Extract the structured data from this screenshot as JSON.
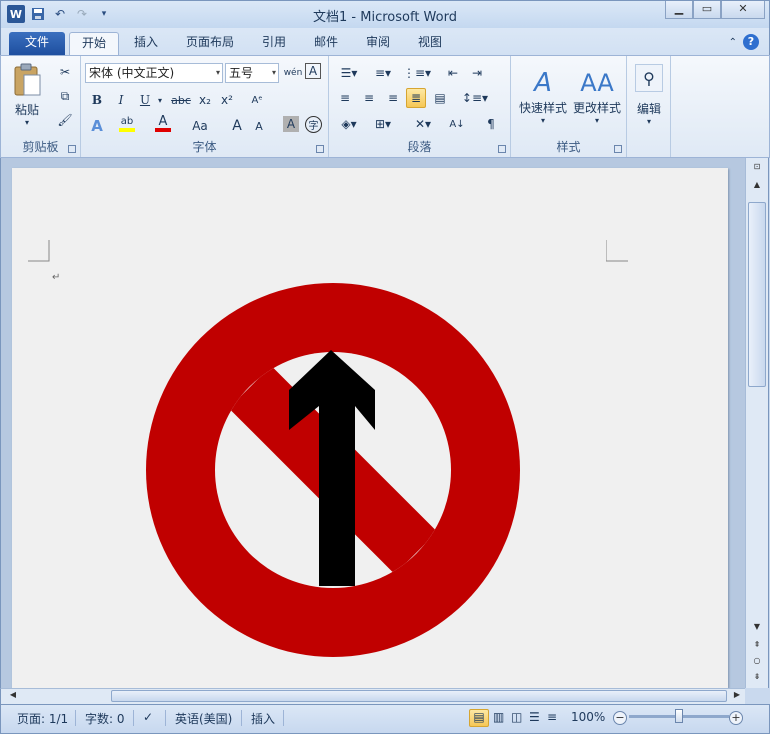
{
  "window": {
    "title": "文档1 - Microsoft Word",
    "quick_access": {
      "logo_text": "W"
    }
  },
  "tabs": [
    {
      "label": "文件"
    },
    {
      "label": "开始"
    },
    {
      "label": "插入"
    },
    {
      "label": "页面布局"
    },
    {
      "label": "引用"
    },
    {
      "label": "邮件"
    },
    {
      "label": "审阅"
    },
    {
      "label": "视图"
    }
  ],
  "ribbon": {
    "clipboard": {
      "label": "剪贴板",
      "paste_label": "粘贴"
    },
    "font": {
      "label": "字体",
      "font_name": "宋体 (中文正文)",
      "font_size": "五号",
      "bold": "B",
      "italic": "I",
      "underline": "U",
      "strike": "abc",
      "subscript": "x₂",
      "superscript": "x²",
      "grow": "A",
      "shrink": "A",
      "change_case": "Aa",
      "phonetic": "wén"
    },
    "paragraph": {
      "label": "段落"
    },
    "styles": {
      "label": "样式",
      "quick_styles": "快速样式",
      "change_styles": "更改样式"
    },
    "editing": {
      "label": "编辑"
    }
  },
  "document": {
    "paragraph_mark": "↵",
    "sign": {
      "ring_color": "#c00000",
      "bg_color": "#f0f0f0",
      "arrow_color": "#000000"
    }
  },
  "status": {
    "page": "页面: 1/1",
    "words": "字数: 0",
    "language": "英语(美国)",
    "mode": "插入",
    "zoom": "100%"
  }
}
